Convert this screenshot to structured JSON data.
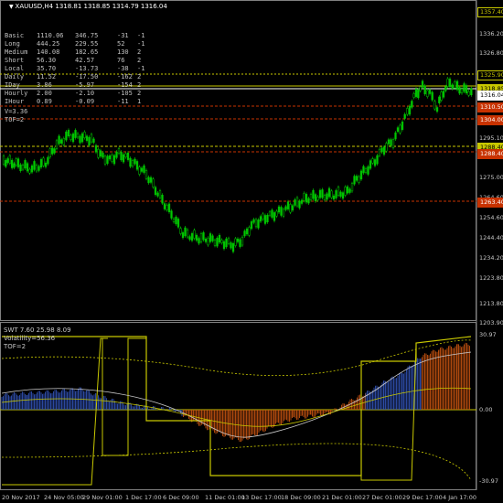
{
  "window": {
    "title": "XAUUSD,H4  1318.81 1318.85 1314.79 1316.04"
  },
  "stats_table": {
    "rows": [
      {
        "label": "Basic",
        "a": "1110.06",
        "b": "346.75",
        "c": "-31",
        "d": "-1"
      },
      {
        "label": "Long",
        "a": "444.25",
        "b": "229.55",
        "c": "52",
        "d": "-1"
      },
      {
        "label": "Medium",
        "a": "140.08",
        "b": "182.65",
        "c": "130",
        "d": "2"
      },
      {
        "label": "Short",
        "a": "56.30",
        "b": "42.57",
        "c": "76",
        "d": "2"
      },
      {
        "label": "Local",
        "a": "35.70",
        "b": "-13.73",
        "c": "-38",
        "d": "-1"
      },
      {
        "label": "Daily",
        "a": "11.52",
        "b": "-17.50",
        "c": "-162",
        "d": "2"
      },
      {
        "label": "IDay",
        "a": "3.86",
        "b": "-5.97",
        "c": "-154",
        "d": "2"
      },
      {
        "label": "Hourly",
        "a": "2.00",
        "b": "-2.10",
        "c": "-105",
        "d": "2"
      },
      {
        "label": "IHour",
        "a": "0.89",
        "b": "-0.09",
        "c": "-11",
        "d": "1"
      }
    ],
    "v_line": "V=3.36",
    "tof_line": "TOF=2"
  },
  "price_axis": {
    "labels": [
      "1336.20",
      "1326.80",
      "1316.04",
      "1305.60",
      "1295.10",
      "1285.20",
      "1275.00",
      "1264.60",
      "1254.60",
      "1244.40",
      "1234.20",
      "1223.80",
      "1213.80",
      "1203.90"
    ],
    "tags": [
      {
        "text": "1357.40",
        "bg": "#000000",
        "fg": "#c8c800",
        "border": "#c8c800"
      },
      {
        "text": "1325.90",
        "bg": "#000000",
        "fg": "#c8c800",
        "border": "#c8c800"
      },
      {
        "text": "1318.85",
        "bg": "#c8c800",
        "fg": "#000000",
        "border": "#c8c800"
      },
      {
        "text": "1316.04",
        "bg": "#ffffff",
        "fg": "#000000",
        "border": "#ffffff"
      },
      {
        "text": "1310.50",
        "bg": "#c83200",
        "fg": "#ffffff",
        "border": "#c83200"
      },
      {
        "text": "1304.00",
        "bg": "#c83200",
        "fg": "#ffffff",
        "border": "#c83200"
      },
      {
        "text": "1288.40",
        "bg": "#c8c800",
        "fg": "#000000",
        "border": "#c8c800"
      },
      {
        "text": "1288.40",
        "bg": "#c83200",
        "fg": "#ffffff",
        "border": "#c83200"
      },
      {
        "text": "1263.40",
        "bg": "#c83200",
        "fg": "#ffffff",
        "border": "#c83200"
      }
    ]
  },
  "indicator_panel": {
    "title": "SWT 7.60 25.98 8.09",
    "volatility": "Volatility=56.36",
    "tof": "TOF=2",
    "axis": [
      "30.97",
      "0.00",
      "-30.97"
    ]
  },
  "time_axis": {
    "labels": [
      "20 Nov 2017",
      "24 Nov 05:00",
      "29 Nov 01:00",
      "1 Dec 17:00",
      "6 Dec 09:00",
      "11 Dec 01:00",
      "13 Dec 17:00",
      "18 Dec 09:00",
      "21 Dec 01:00",
      "27 Dec 01:00",
      "29 Dec 17:00",
      "4 Jan 17:00"
    ]
  },
  "colors": {
    "bull_candle": "#00c800",
    "level_yellow": "#c8c800",
    "level_red": "#c83200",
    "fill_blue": "#3050b0",
    "fill_orange": "#c05010"
  }
}
